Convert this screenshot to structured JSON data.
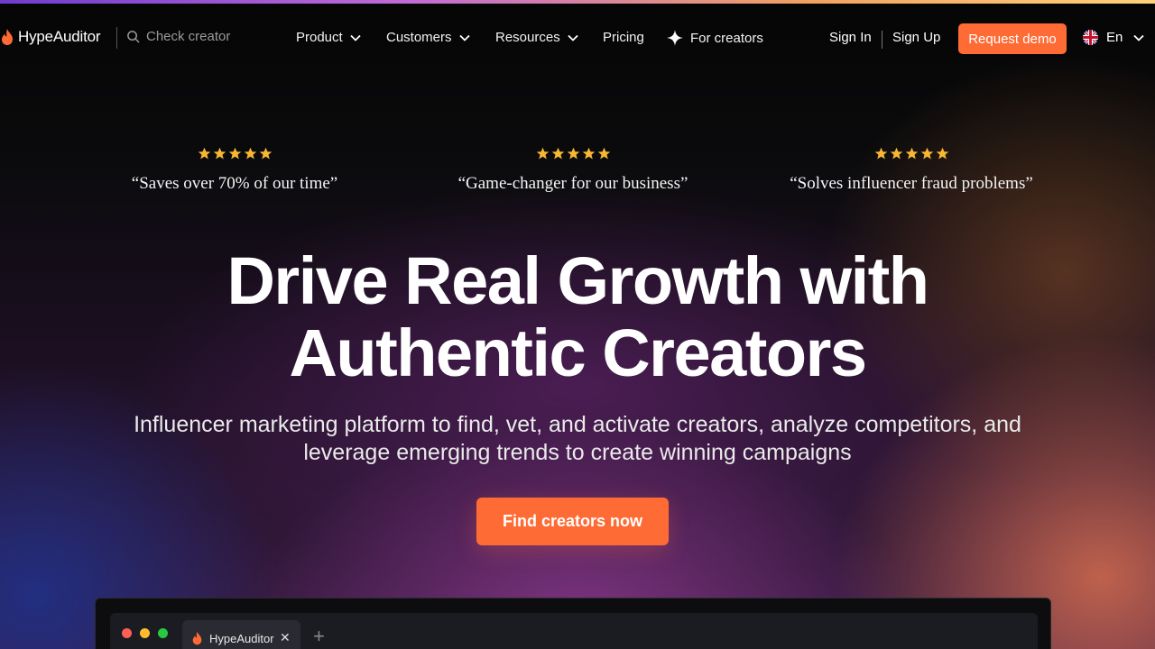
{
  "brand": {
    "name": "HypeAuditor",
    "flame_color": "#ff6b35"
  },
  "search": {
    "placeholder": "Check creator",
    "icon": "search-icon"
  },
  "nav": {
    "items": [
      {
        "label": "Product",
        "has_dropdown": true
      },
      {
        "label": "Customers",
        "has_dropdown": true
      },
      {
        "label": "Resources",
        "has_dropdown": true
      },
      {
        "label": "Pricing",
        "has_dropdown": false
      },
      {
        "label": "For creators",
        "icon": "sparkle-icon",
        "has_dropdown": false
      }
    ],
    "sign_in": "Sign In",
    "sign_up": "Sign Up",
    "request_demo": "Request demo",
    "language": "En"
  },
  "reviews": [
    {
      "rating": 5,
      "quote": "“Saves over 70% of our time”"
    },
    {
      "rating": 5,
      "quote": "“Game-changer for our business”"
    },
    {
      "rating": 5,
      "quote": "“Solves influencer fraud problems”"
    }
  ],
  "hero": {
    "title_line1": "Drive Real Growth with",
    "title_line2": "Authentic Creators",
    "subtitle_line1": "Influencer marketing platform to find, vet, and activate creators, analyze competitors, and",
    "subtitle_line2": "leverage emerging trends to create winning campaigns",
    "cta": "Find creators now"
  },
  "browser_mock": {
    "tab_label": "HypeAuditor",
    "tab_close": "✕",
    "new_tab": "+",
    "dot_colors": [
      "#ff5f57",
      "#febc2e",
      "#28c840"
    ]
  },
  "colors": {
    "accent": "#ff6b35",
    "star": "#f7b733",
    "background": "#0b0b0d"
  }
}
